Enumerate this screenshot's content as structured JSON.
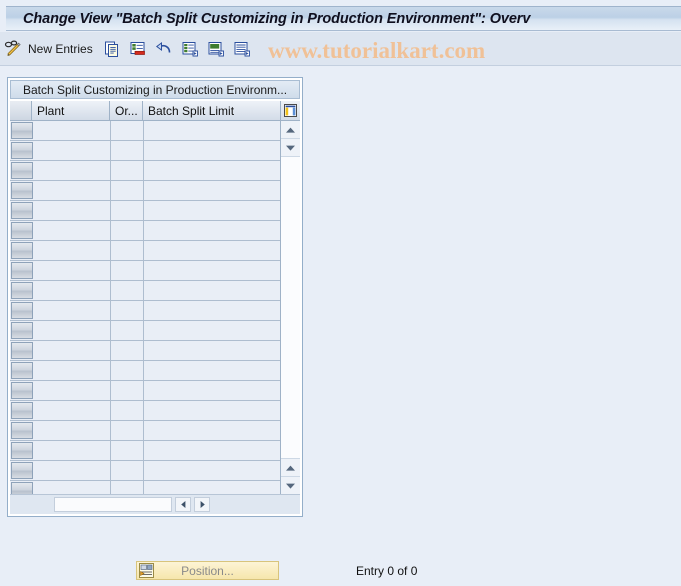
{
  "window": {
    "title": "Change View \"Batch Split Customizing in Production Environment\": Overv"
  },
  "watermark": {
    "text": "www.tutorialkart.com",
    "color": "#f0c197"
  },
  "toolbar": {
    "display_change_icon": "glasses-pencil-icon",
    "new_entries_label": "New Entries",
    "buttons": [
      {
        "name": "copy-as-icon",
        "label": "Copy As..."
      },
      {
        "name": "delete-icon",
        "label": "Delete"
      },
      {
        "name": "undo-icon",
        "label": "Undo Change"
      },
      {
        "name": "select-all-icon",
        "label": "Select All"
      },
      {
        "name": "select-block-icon",
        "label": "Select Block"
      },
      {
        "name": "deselect-all-icon",
        "label": "Deselect All"
      }
    ]
  },
  "table": {
    "caption": "Batch Split Customizing in Production Environm...",
    "columns": [
      {
        "key": "plant",
        "label": "Plant"
      },
      {
        "key": "order_type",
        "label": "Or..."
      },
      {
        "key": "batch_split_limit",
        "label": "Batch Split Limit"
      }
    ],
    "column_config_icon": "table-settings-icon",
    "rows": [],
    "empty_row_count": 19,
    "vertical_scroll": {
      "up_arrow": "caret-up-icon",
      "down_arrow": "caret-down-icon"
    },
    "horizontal_scroll": {
      "left_arrow": "caret-left-icon",
      "right_arrow": "caret-right-icon"
    }
  },
  "footer": {
    "position_button_label": "Position...",
    "position_button_icon": "position-icon",
    "entry_status": "Entry 0 of 0"
  },
  "colors": {
    "background": "#e8eef7",
    "title_bar": "#bcd0e6",
    "toolbar": "#dde5f0",
    "grid_line": "#aebdcf",
    "cell_background": "#e9eef6",
    "button_yellow": "#f6e6ac"
  }
}
